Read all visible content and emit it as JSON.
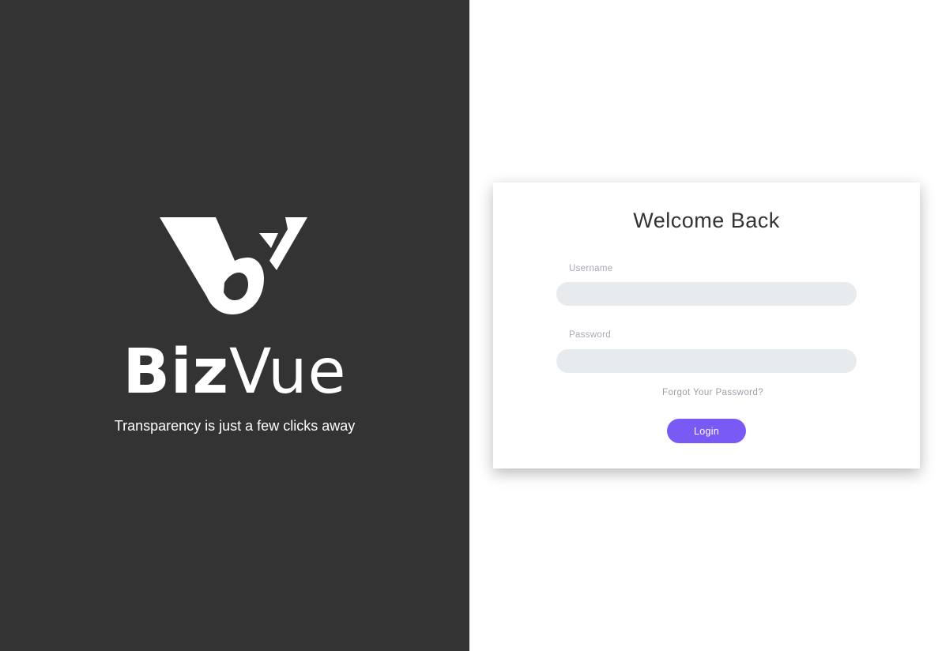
{
  "brand": {
    "name_bold": "Biz",
    "name_light": "Vue",
    "tagline": "Transparency is just a few clicks away",
    "logo_icon": "bizvue-logo-mark",
    "panel_color": "#333333"
  },
  "login": {
    "title": "Welcome Back",
    "username_label": "Username",
    "username_value": "",
    "password_label": "Password",
    "password_value": "",
    "forgot_password": "Forgot Your Password?",
    "login_button": "Login",
    "accent_color": "#7a5af5",
    "input_bg_color": "#e8ebee"
  }
}
